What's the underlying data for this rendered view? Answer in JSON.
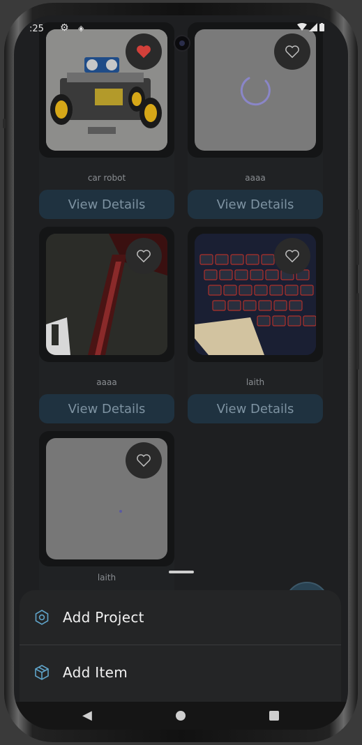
{
  "status_bar": {
    "time": ":25",
    "gear_icon": "gear-icon",
    "extra_icon": "notification-dot-icon",
    "wifi_icon": "wifi-icon",
    "signal_icon": "cell-signal-icon",
    "battery_icon": "battery-icon"
  },
  "cards": [
    {
      "title": "car robot",
      "button": "View Details",
      "favorited": true,
      "image": "robot-car-photo"
    },
    {
      "title": "aaaa",
      "button": "View Details",
      "favorited": false,
      "image": "loading-placeholder"
    },
    {
      "title": "aaaa",
      "button": "View Details",
      "favorited": false,
      "image": "dark-photo"
    },
    {
      "title": "laith",
      "button": "View Details",
      "favorited": false,
      "image": "keyboard-photo"
    },
    {
      "title": "laith",
      "button": "",
      "favorited": false,
      "image": "blank-placeholder"
    }
  ],
  "sheet": {
    "add_project": "Add Project",
    "add_item": "Add Item",
    "project_icon": "hexagon-icon",
    "item_icon": "box-icon"
  },
  "nav": {
    "back_icon": "back-triangle-icon",
    "home_icon": "home-circle-icon",
    "recent_icon": "recents-square-icon"
  },
  "colors": {
    "favorite": "#d2403a",
    "button_bg": "#1f3240",
    "accent": "#5fa3c8"
  }
}
